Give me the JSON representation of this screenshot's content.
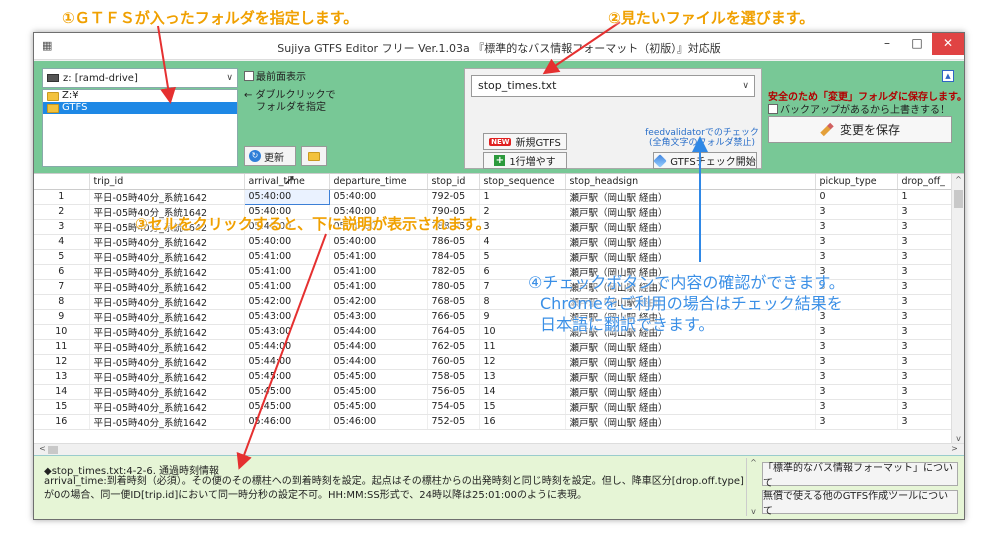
{
  "callouts": {
    "c1": "①ＧＴＦＳが入ったフォルダを指定します。",
    "c2": "②見たいファイルを選びます。",
    "c3": "③セルをクリックすると、下に説明が表示されます。",
    "c4_line1": "④チェックボタンで内容の確認ができます。",
    "c4_line2": "Chromeをご利用の場合はチェック結果を",
    "c4_line3": "日本語に翻訳できます。"
  },
  "window": {
    "title": "Sujiya GTFS Editor フリー  Ver.1.03a 『標準的なバス情報フォーマット（初版）』対応版",
    "min": "–",
    "max": "□",
    "close": "✕"
  },
  "drive": {
    "selected": "z: [ramd-drive]",
    "folders": [
      {
        "label": "Z:¥"
      },
      {
        "label": "GTFS"
      }
    ]
  },
  "options": {
    "topmost": "最前面表示",
    "hint_line1": "← ダブルクリックで",
    "hint_line2": "フォルダを指定",
    "refresh": "更新"
  },
  "file": {
    "selected": "stop_times.txt",
    "new_badge": "NEW",
    "new_label": "新規GTFS",
    "addrow_label": "1行増やす",
    "fv_line1": "feedvalidatorでのチェック",
    "fv_line2": "(全角文字のフォルダ禁止)",
    "check_label": "GTFSチェック開始"
  },
  "save": {
    "warning": "安全のため「変更」フォルダに保存します。",
    "overwrite": "バックアップがあるから上書きする！",
    "button": "変更を保存"
  },
  "grid": {
    "columns": [
      "",
      "trip_id",
      "arrival_time",
      "departure_time",
      "stop_id",
      "stop_sequence",
      "stop_headsign",
      "pickup_type",
      "drop_off_"
    ],
    "rows": [
      [
        "1",
        "平日-05時40分_系統1642",
        "05:40:00",
        "05:40:00",
        "792-05",
        "1",
        "瀬戸駅（岡山駅 経由）",
        "0",
        "1"
      ],
      [
        "2",
        "平日-05時40分_系統1642",
        "05:40:00",
        "05:40:00",
        "790-05",
        "2",
        "瀬戸駅（岡山駅 経由）",
        "3",
        "3"
      ],
      [
        "3",
        "平日-05時40分_系統1642",
        "05:40:00",
        "05:40:00",
        "788-05",
        "3",
        "瀬戸駅（岡山駅 経由）",
        "3",
        "3"
      ],
      [
        "4",
        "平日-05時40分_系統1642",
        "05:40:00",
        "05:40:00",
        "786-05",
        "4",
        "瀬戸駅（岡山駅 経由）",
        "3",
        "3"
      ],
      [
        "5",
        "平日-05時40分_系統1642",
        "05:41:00",
        "05:41:00",
        "784-05",
        "5",
        "瀬戸駅（岡山駅 経由）",
        "3",
        "3"
      ],
      [
        "6",
        "平日-05時40分_系統1642",
        "05:41:00",
        "05:41:00",
        "782-05",
        "6",
        "瀬戸駅（岡山駅 経由）",
        "3",
        "3"
      ],
      [
        "7",
        "平日-05時40分_系統1642",
        "05:41:00",
        "05:41:00",
        "780-05",
        "7",
        "瀬戸駅（岡山駅 経由）",
        "3",
        "3"
      ],
      [
        "8",
        "平日-05時40分_系統1642",
        "05:42:00",
        "05:42:00",
        "768-05",
        "8",
        "瀬戸駅（岡山駅 経由）",
        "3",
        "3"
      ],
      [
        "9",
        "平日-05時40分_系統1642",
        "05:43:00",
        "05:43:00",
        "766-05",
        "9",
        "瀬戸駅（岡山駅 経由）",
        "3",
        "3"
      ],
      [
        "10",
        "平日-05時40分_系統1642",
        "05:43:00",
        "05:44:00",
        "764-05",
        "10",
        "瀬戸駅（岡山駅 経由）",
        "3",
        "3"
      ],
      [
        "11",
        "平日-05時40分_系統1642",
        "05:44:00",
        "05:44:00",
        "762-05",
        "11",
        "瀬戸駅（岡山駅 経由）",
        "3",
        "3"
      ],
      [
        "12",
        "平日-05時40分_系統1642",
        "05:44:00",
        "05:44:00",
        "760-05",
        "12",
        "瀬戸駅（岡山駅 経由）",
        "3",
        "3"
      ],
      [
        "13",
        "平日-05時40分_系統1642",
        "05:45:00",
        "05:45:00",
        "758-05",
        "13",
        "瀬戸駅（岡山駅 経由）",
        "3",
        "3"
      ],
      [
        "14",
        "平日-05時40分_系統1642",
        "05:45:00",
        "05:45:00",
        "756-05",
        "14",
        "瀬戸駅（岡山駅 経由）",
        "3",
        "3"
      ],
      [
        "15",
        "平日-05時40分_系統1642",
        "05:45:00",
        "05:45:00",
        "754-05",
        "15",
        "瀬戸駅（岡山駅 経由）",
        "3",
        "3"
      ],
      [
        "16",
        "平日-05時40分_系統1642",
        "05:46:00",
        "05:46:00",
        "752-05",
        "16",
        "瀬戸駅（岡山駅 経由）",
        "3",
        "3"
      ]
    ]
  },
  "description": {
    "title": "◆stop_times.txt:4-2-6. 通過時刻情報",
    "body": "arrival_time:到着時刻（必須）。その便のその標柱への到着時刻を設定。起点はその標柱からの出発時刻と同じ時刻を設定。但し、降車区分[drop.off.type]が0の場合、同一便ID[trip.id]において同一時分秒の設定不可。HH:MM:SS形式で、24時以降は25:01:00のように表現。",
    "btn_format": "「標準的なバス情報フォーマット」について",
    "btn_tools": "無償で使える他のGTFS作成ツールについて"
  }
}
